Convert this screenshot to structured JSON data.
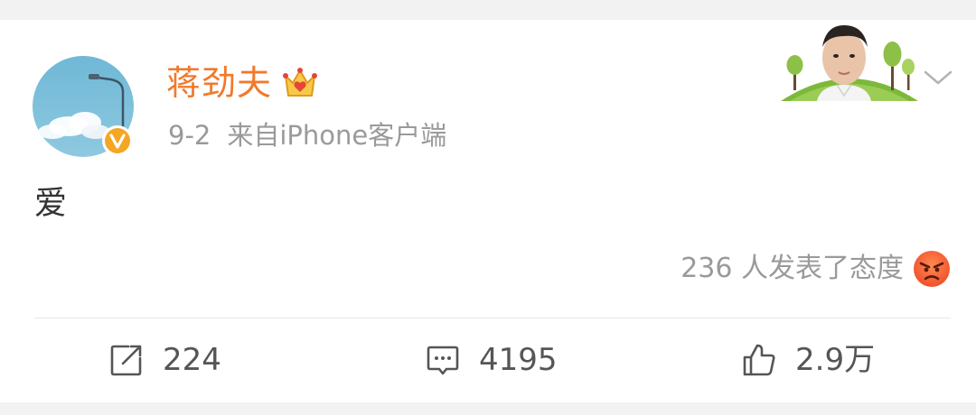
{
  "post": {
    "author": "蒋劲夫",
    "date": "9-2",
    "source": "来自iPhone客户端",
    "text": "爱",
    "reactions_summary": "236 人发表了态度",
    "reaction_icon": "angry-face-emoji",
    "badge_icon": "verified-v-icon",
    "vip_icon": "crown-icon"
  },
  "actions": {
    "repost_count": "224",
    "comment_count": "4195",
    "like_count": "2.9万"
  },
  "colors": {
    "author_name": "#f2792b",
    "meta_text": "#9a9a9a",
    "badge": "#f5a623",
    "page_bg": "#f2f2f2"
  }
}
